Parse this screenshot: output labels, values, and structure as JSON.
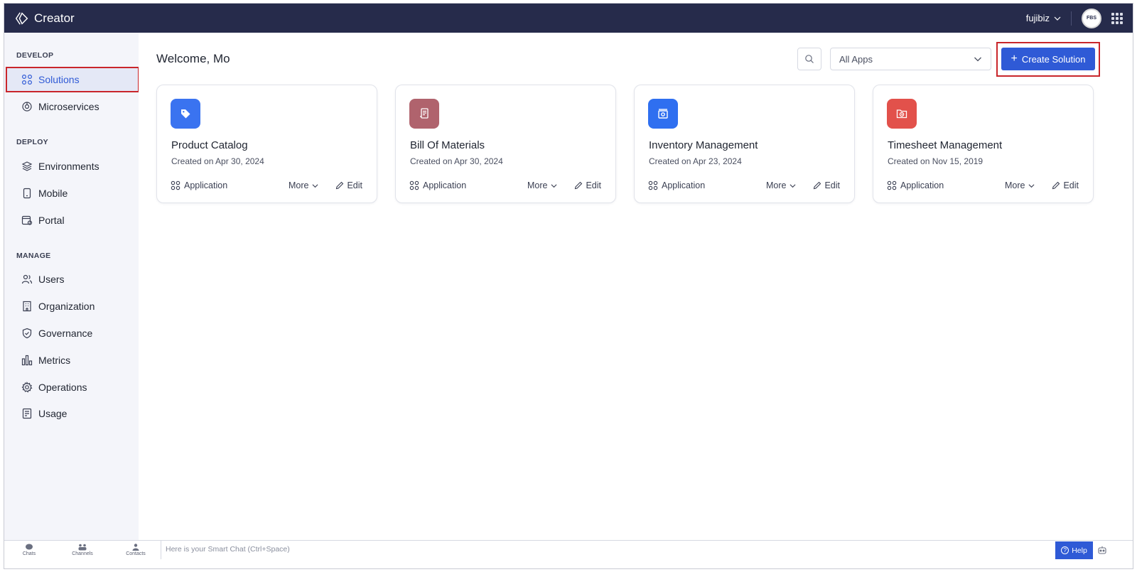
{
  "app": {
    "name": "Creator"
  },
  "header": {
    "org_name": "fujibiz",
    "avatar_text": "FBS"
  },
  "sidebar": {
    "sections": [
      {
        "label": "DEVELOP"
      },
      {
        "label": "DEPLOY"
      },
      {
        "label": "MANAGE"
      }
    ],
    "items": [
      {
        "label": "Solutions",
        "icon": "solutions-icon",
        "active": true
      },
      {
        "label": "Microservices",
        "icon": "microservices-icon"
      },
      {
        "label": "Environments",
        "icon": "layers-icon"
      },
      {
        "label": "Mobile",
        "icon": "mobile-icon"
      },
      {
        "label": "Portal",
        "icon": "portal-icon"
      },
      {
        "label": "Users",
        "icon": "users-icon"
      },
      {
        "label": "Organization",
        "icon": "building-icon"
      },
      {
        "label": "Governance",
        "icon": "shield-icon"
      },
      {
        "label": "Metrics",
        "icon": "bar-chart-icon"
      },
      {
        "label": "Operations",
        "icon": "gear-icon"
      },
      {
        "label": "Usage",
        "icon": "receipt-icon"
      }
    ]
  },
  "main": {
    "welcome": "Welcome, Mo",
    "filter": {
      "selected": "All Apps"
    },
    "create_button": "Create Solution",
    "cards": [
      {
        "title": "Product Catalog",
        "created": "Created on Apr 30, 2024",
        "type": "Application",
        "more": "More",
        "edit": "Edit",
        "icon": "tag-icon",
        "color": "#3a73f0"
      },
      {
        "title": "Bill Of Materials",
        "created": "Created on Apr 30, 2024",
        "type": "Application",
        "more": "More",
        "edit": "Edit",
        "icon": "document-icon",
        "color": "#b0636d"
      },
      {
        "title": "Inventory Management",
        "created": "Created on Apr 23, 2024",
        "type": "Application",
        "more": "More",
        "edit": "Edit",
        "icon": "box-icon",
        "color": "#2f6ff0"
      },
      {
        "title": "Timesheet Management",
        "created": "Created on Nov 15, 2019",
        "type": "Application",
        "more": "More",
        "edit": "Edit",
        "icon": "clock-folder-icon",
        "color": "#e2514b"
      }
    ]
  },
  "bottombar": {
    "tabs": [
      {
        "label": "Chats"
      },
      {
        "label": "Channels"
      },
      {
        "label": "Contacts"
      }
    ],
    "chat_placeholder": "Here is your Smart Chat (Ctrl+Space)",
    "help_label": "Help"
  },
  "colors": {
    "topbar": "#262b4b",
    "accent": "#2f5ad6",
    "highlight": "#c9262b",
    "sidebar_bg": "#f4f5fa"
  }
}
